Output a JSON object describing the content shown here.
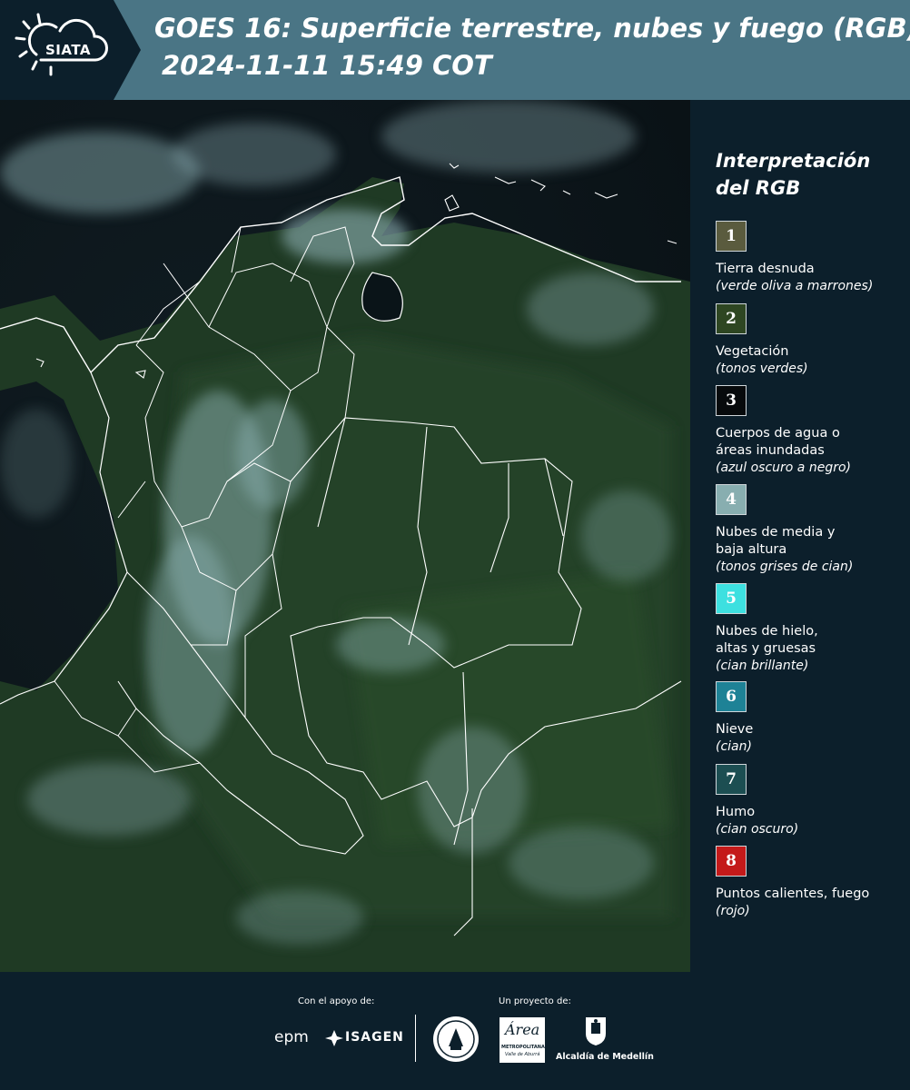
{
  "header": {
    "logo_text": "SIATA",
    "title": "GOES 16: Superficie terrestre, nubes y fuego (RGB)",
    "datetime": "2024-11-11 15:49 COT"
  },
  "legend": {
    "title_line1": "Interpretación",
    "title_line2": "del RGB",
    "items": [
      {
        "num": "1",
        "color": "#5a5b3e",
        "label": "Tierra desnuda",
        "sub": "(verde oliva a marrones)"
      },
      {
        "num": "2",
        "color": "#2e4622",
        "label": "Vegetación",
        "sub": "(tonos verdes)"
      },
      {
        "num": "3",
        "color": "#070a0c",
        "label": "Cuerpos de agua o áreas inundadas",
        "sub": "(azul oscuro a negro)"
      },
      {
        "num": "4",
        "color": "#88aeb0",
        "label": "Nubes de media y baja altura",
        "sub": "(tonos grises de cian)"
      },
      {
        "num": "5",
        "color": "#3de0e0",
        "label": "Nubes de hielo, altas y gruesas",
        "sub": "(cian brillante)"
      },
      {
        "num": "6",
        "color": "#1e8296",
        "label": "Nieve",
        "sub": "(cian)"
      },
      {
        "num": "7",
        "color": "#1c4e52",
        "label": "Humo",
        "sub": "(cian oscuro)"
      },
      {
        "num": "8",
        "color": "#c41a1a",
        "label": "Puntos calientes, fuego",
        "sub": "(rojo)"
      }
    ]
  },
  "footer": {
    "support_label": "Con el apoyo de:",
    "project_label": "Un proyecto de:",
    "sponsor1": "epm",
    "sponsor2": "ISAGEN",
    "partner_area_line1": "Área",
    "partner_area_line2": "METROPOLITANA",
    "partner_area_line3": "Valle de Aburrá",
    "partner_medellin": "Alcaldía de Medellín"
  }
}
